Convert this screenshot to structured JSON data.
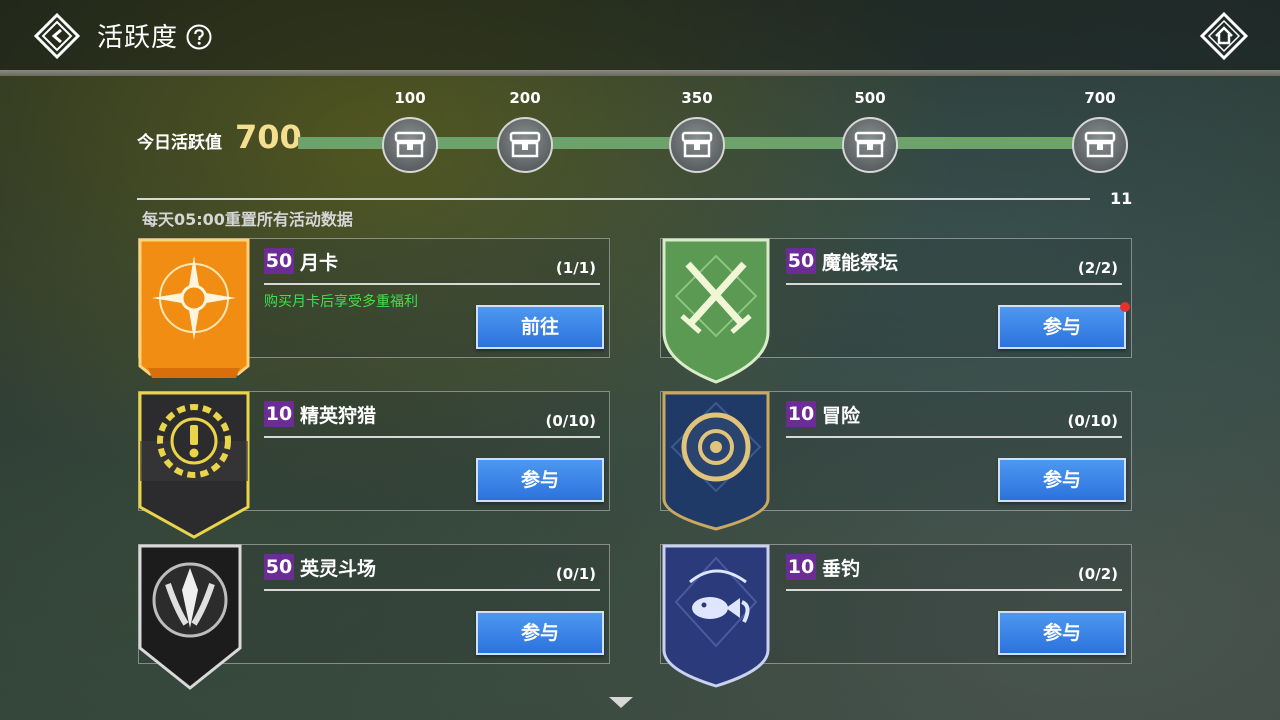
{
  "header": {
    "title": "活跃度"
  },
  "activity": {
    "label": "今日活跃值",
    "value": "700",
    "milestones": [
      {
        "label": "100"
      },
      {
        "label": "200"
      },
      {
        "label": "350"
      },
      {
        "label": "500"
      },
      {
        "label": "700"
      }
    ],
    "track_count": "11",
    "reset_note": "每天05:00重置所有活动数据"
  },
  "cards": [
    {
      "points": "50",
      "name": "月卡",
      "progress": "(1/1)",
      "desc": "购买月卡后享受多重福利",
      "button": "前往",
      "emblem": "orange-sun-banner-icon"
    },
    {
      "points": "50",
      "name": "魔能祭坛",
      "progress": "(2/2)",
      "desc": "",
      "button": "参与",
      "emblem": "green-crossed-swords-shield-icon"
    },
    {
      "points": "10",
      "name": "精英狩猎",
      "progress": "(0/10)",
      "desc": "",
      "button": "参与",
      "emblem": "black-yellow-alert-banner-icon"
    },
    {
      "points": "10",
      "name": "冒险",
      "progress": "(0/10)",
      "desc": "",
      "button": "参与",
      "emblem": "blue-gold-compass-shield-icon"
    },
    {
      "points": "50",
      "name": "英灵斗场",
      "progress": "(0/1)",
      "desc": "",
      "button": "参与",
      "emblem": "black-silver-crest-banner-icon"
    },
    {
      "points": "10",
      "name": "垂钓",
      "progress": "(0/2)",
      "desc": "",
      "button": "参与",
      "emblem": "navy-fish-shield-icon"
    }
  ],
  "colors": {
    "accent_gold": "#f3df8f",
    "track_green": "#6da36a",
    "points_purple": "#6b2c96",
    "button_blue": "#3b86e8",
    "desc_green": "#3ee14b"
  }
}
